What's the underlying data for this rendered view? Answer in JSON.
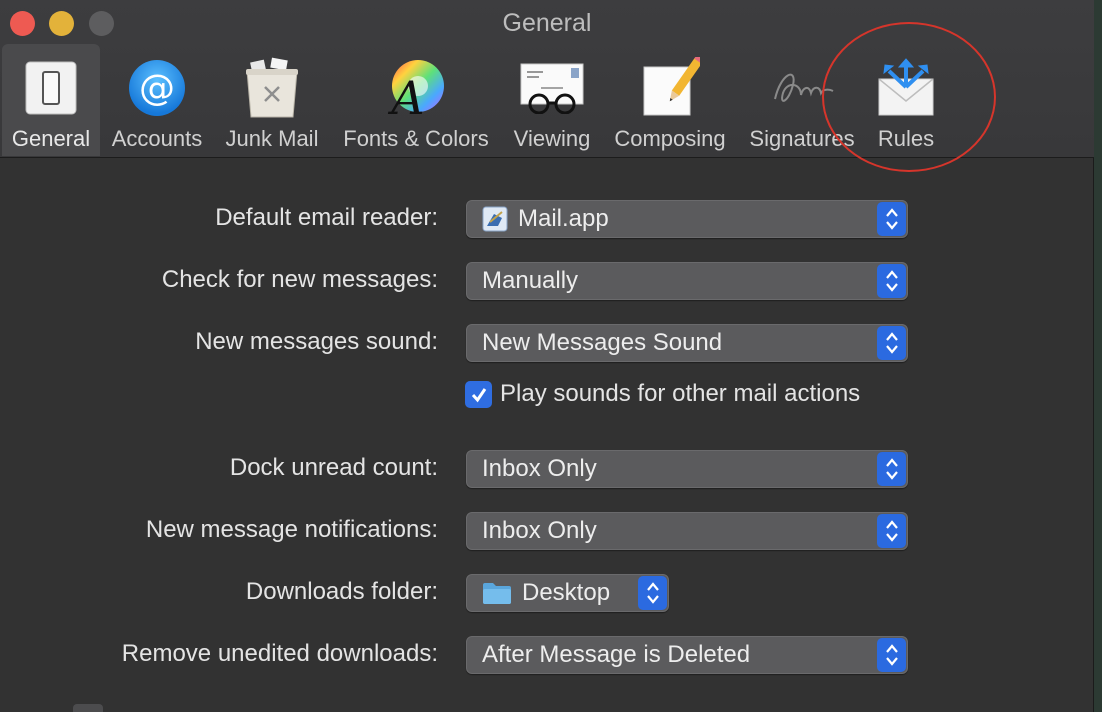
{
  "window": {
    "title": "General"
  },
  "toolbar": {
    "items": [
      {
        "label": "General",
        "icon": "switch-icon",
        "selected": true
      },
      {
        "label": "Accounts",
        "icon": "at-sign-icon"
      },
      {
        "label": "Junk Mail",
        "icon": "trash-bin-icon"
      },
      {
        "label": "Fonts & Colors",
        "icon": "font-color-wheel-icon"
      },
      {
        "label": "Viewing",
        "icon": "envelope-glasses-icon"
      },
      {
        "label": "Composing",
        "icon": "paper-pencil-icon"
      },
      {
        "label": "Signatures",
        "icon": "signature-icon"
      },
      {
        "label": "Rules",
        "icon": "envelope-arrows-icon"
      }
    ]
  },
  "form": {
    "default_reader": {
      "label": "Default email reader:",
      "value": "Mail.app"
    },
    "check_messages": {
      "label": "Check for new messages:",
      "value": "Manually"
    },
    "new_sound": {
      "label": "New messages sound:",
      "value": "New Messages Sound"
    },
    "play_sounds": {
      "label": "Play sounds for other mail actions",
      "checked": true
    },
    "dock_count": {
      "label": "Dock unread count:",
      "value": "Inbox Only"
    },
    "notifications": {
      "label": "New message notifications:",
      "value": "Inbox Only"
    },
    "downloads_folder": {
      "label": "Downloads folder:",
      "value": "Desktop"
    },
    "remove_downloads": {
      "label": "Remove unedited downloads:",
      "value": "After Message is Deleted"
    }
  },
  "colors": {
    "accent": "#2b6ae0",
    "close": "#ee5a52",
    "minimize": "#e3b23a",
    "annotation": "#d6352b"
  }
}
